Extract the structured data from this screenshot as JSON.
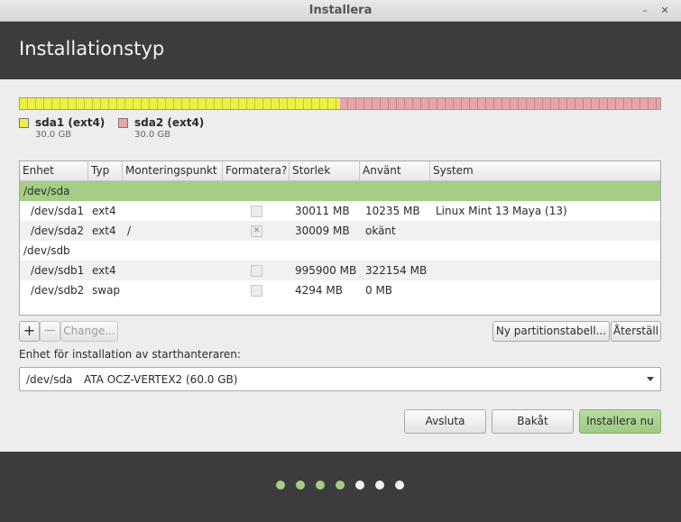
{
  "window": {
    "title": "Installera",
    "minimize_glyph": "–",
    "close_glyph": "✕"
  },
  "header": {
    "title": "Installationstyp"
  },
  "disk_bar": {
    "segments": [
      {
        "name": "sda1 (ext4)",
        "size": "30.0 GB",
        "color": "#eef046",
        "share": 0.5
      },
      {
        "name": "sda2 (ext4)",
        "size": "30.0 GB",
        "color": "#e8a5a8",
        "share": 0.5
      }
    ]
  },
  "table": {
    "columns": [
      "Enhet",
      "Typ",
      "Monteringspunkt",
      "Formatera?",
      "Storlek",
      "Använt",
      "System"
    ],
    "rows": [
      {
        "device": "/dev/sda",
        "type": "",
        "mount": "",
        "format": null,
        "size": "",
        "used": "",
        "system": "",
        "selected": true
      },
      {
        "device": "/dev/sda1",
        "type": "ext4",
        "mount": "",
        "format": false,
        "size": "30011 MB",
        "used": "10235 MB",
        "system": "Linux Mint 13 Maya (13)"
      },
      {
        "device": "/dev/sda2",
        "type": "ext4",
        "mount": "/",
        "format": true,
        "size": "30009 MB",
        "used": "okänt",
        "system": ""
      },
      {
        "device": "/dev/sdb",
        "type": "",
        "mount": "",
        "format": null,
        "size": "",
        "used": "",
        "system": ""
      },
      {
        "device": "/dev/sdb1",
        "type": "ext4",
        "mount": "",
        "format": false,
        "size": "995900 MB",
        "used": "322154 MB",
        "system": ""
      },
      {
        "device": "/dev/sdb2",
        "type": "swap",
        "mount": "",
        "format": false,
        "size": "4294 MB",
        "used": "0 MB",
        "system": ""
      }
    ]
  },
  "toolbar": {
    "add": "+",
    "remove": "—",
    "change": "Change...",
    "new_table": "Ny partitionstabell...",
    "revert": "Återställ"
  },
  "bootloader": {
    "label": "Enhet för installation av starthanteraren:",
    "device": "/dev/sda",
    "model": "ATA OCZ-VERTEX2 (60.0 GB)"
  },
  "buttons": {
    "quit": "Avsluta",
    "back": "Bakåt",
    "install": "Installera nu"
  },
  "progress": {
    "steps_done": 4,
    "steps_total": 7
  },
  "colors": {
    "selection": "#a5cd86",
    "primary_button": "#a5cd86",
    "header": "#3c3c3c"
  }
}
